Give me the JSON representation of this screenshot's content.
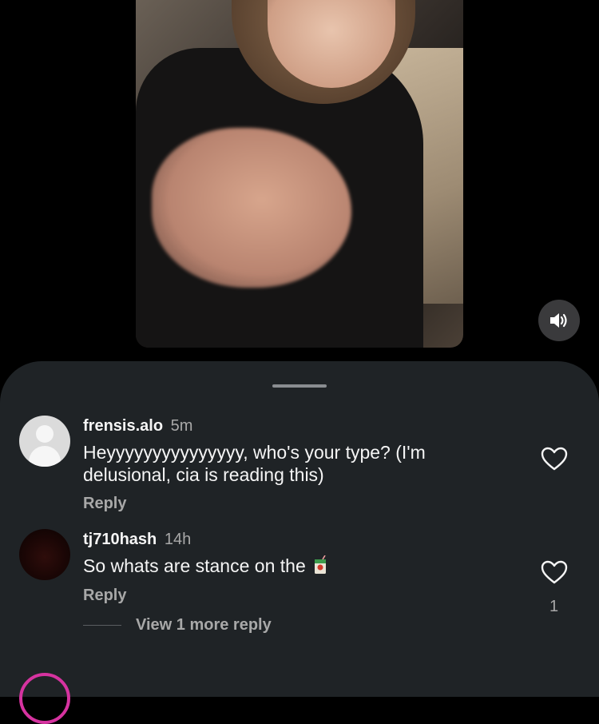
{
  "video": {
    "mute_icon": "speaker-icon"
  },
  "comments": [
    {
      "username": "frensis.alo",
      "time": "5m",
      "text": "Heyyyyyyyyyyyyyyy, who's your type? (I'm delusional, cia is reading this)",
      "reply_label": "Reply",
      "avatar": "default-avatar"
    },
    {
      "username": "tj710hash",
      "time": "14h",
      "text": "So whats are stance on the",
      "emoji": "juice-box-icon",
      "reply_label": "Reply",
      "likes": "1",
      "view_more_label": "View 1 more reply",
      "avatar": "dark-avatar"
    }
  ],
  "colors": {
    "sheet_bg": "#1f2326",
    "secondary_text": "#a8a8a8",
    "story_ring": "#d633a0"
  }
}
